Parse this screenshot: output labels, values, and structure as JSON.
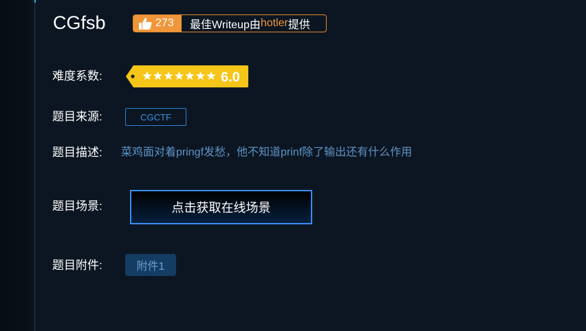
{
  "challenge": {
    "title": "CGfsb",
    "likes": "273",
    "writeup_prefix": "最佳Writeup由",
    "writeup_author": "hotler",
    "writeup_suffix": "提供"
  },
  "fields": {
    "difficulty_label": "难度系数:",
    "difficulty_stars": 7,
    "difficulty_value": "6.0",
    "source_label": "题目来源:",
    "source_value": "CGCTF",
    "description_label": "题目描述:",
    "description_value": "菜鸡面对着pringf发愁，他不知道prinf除了输出还有什么作用",
    "scene_label": "题目场景:",
    "scene_button": "点击获取在线场景",
    "attachment_label": "题目附件:",
    "attachment_value": "附件1"
  },
  "colors": {
    "background": "#0c1622",
    "like_orange": "#f0963a",
    "difficulty_gold": "#f5c518",
    "link_blue": "#3b8fe0",
    "description_blue": "#5f93c6"
  }
}
